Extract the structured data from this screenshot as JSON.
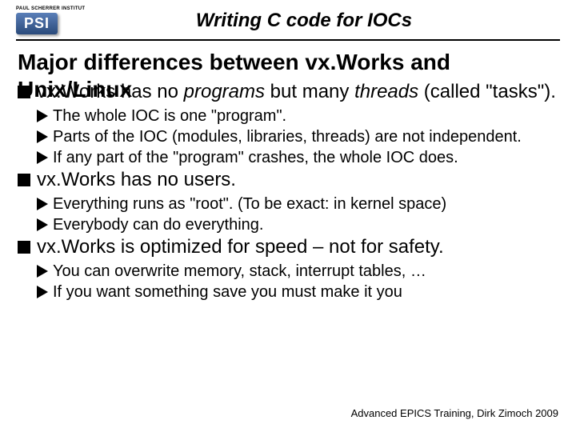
{
  "logo": {
    "top": "PAUL SCHERRER INSTITUT",
    "badge": "PSI"
  },
  "title": "Writing C code for IOCs",
  "heading_line1": "Major differences between vx.Works and",
  "heading_line2": "Unix/Linux",
  "bullets": [
    {
      "text_pre": "vx.Works has no ",
      "em1": "programs",
      "mid": " but many ",
      "em2": "threads",
      "text_post": " (called \"tasks\").",
      "subs": [
        "The whole IOC is one \"program\".",
        "Parts of the IOC (modules, libraries, threads) are not independent.",
        "If any part of the \"program\" crashes, the whole IOC does."
      ]
    },
    {
      "plain": "vx.Works has no users.",
      "subs": [
        "Everything runs as \"root\". (To be exact: in kernel space)",
        "Everybody can do everything."
      ]
    },
    {
      "plain": "vx.Works is optimized for speed – not for safety.",
      "subs": [
        "You can overwrite memory, stack, interrupt tables, …",
        "If you want something save you must make it you"
      ]
    }
  ],
  "footer": "Advanced EPICS Training, Dirk Zimoch 2009"
}
